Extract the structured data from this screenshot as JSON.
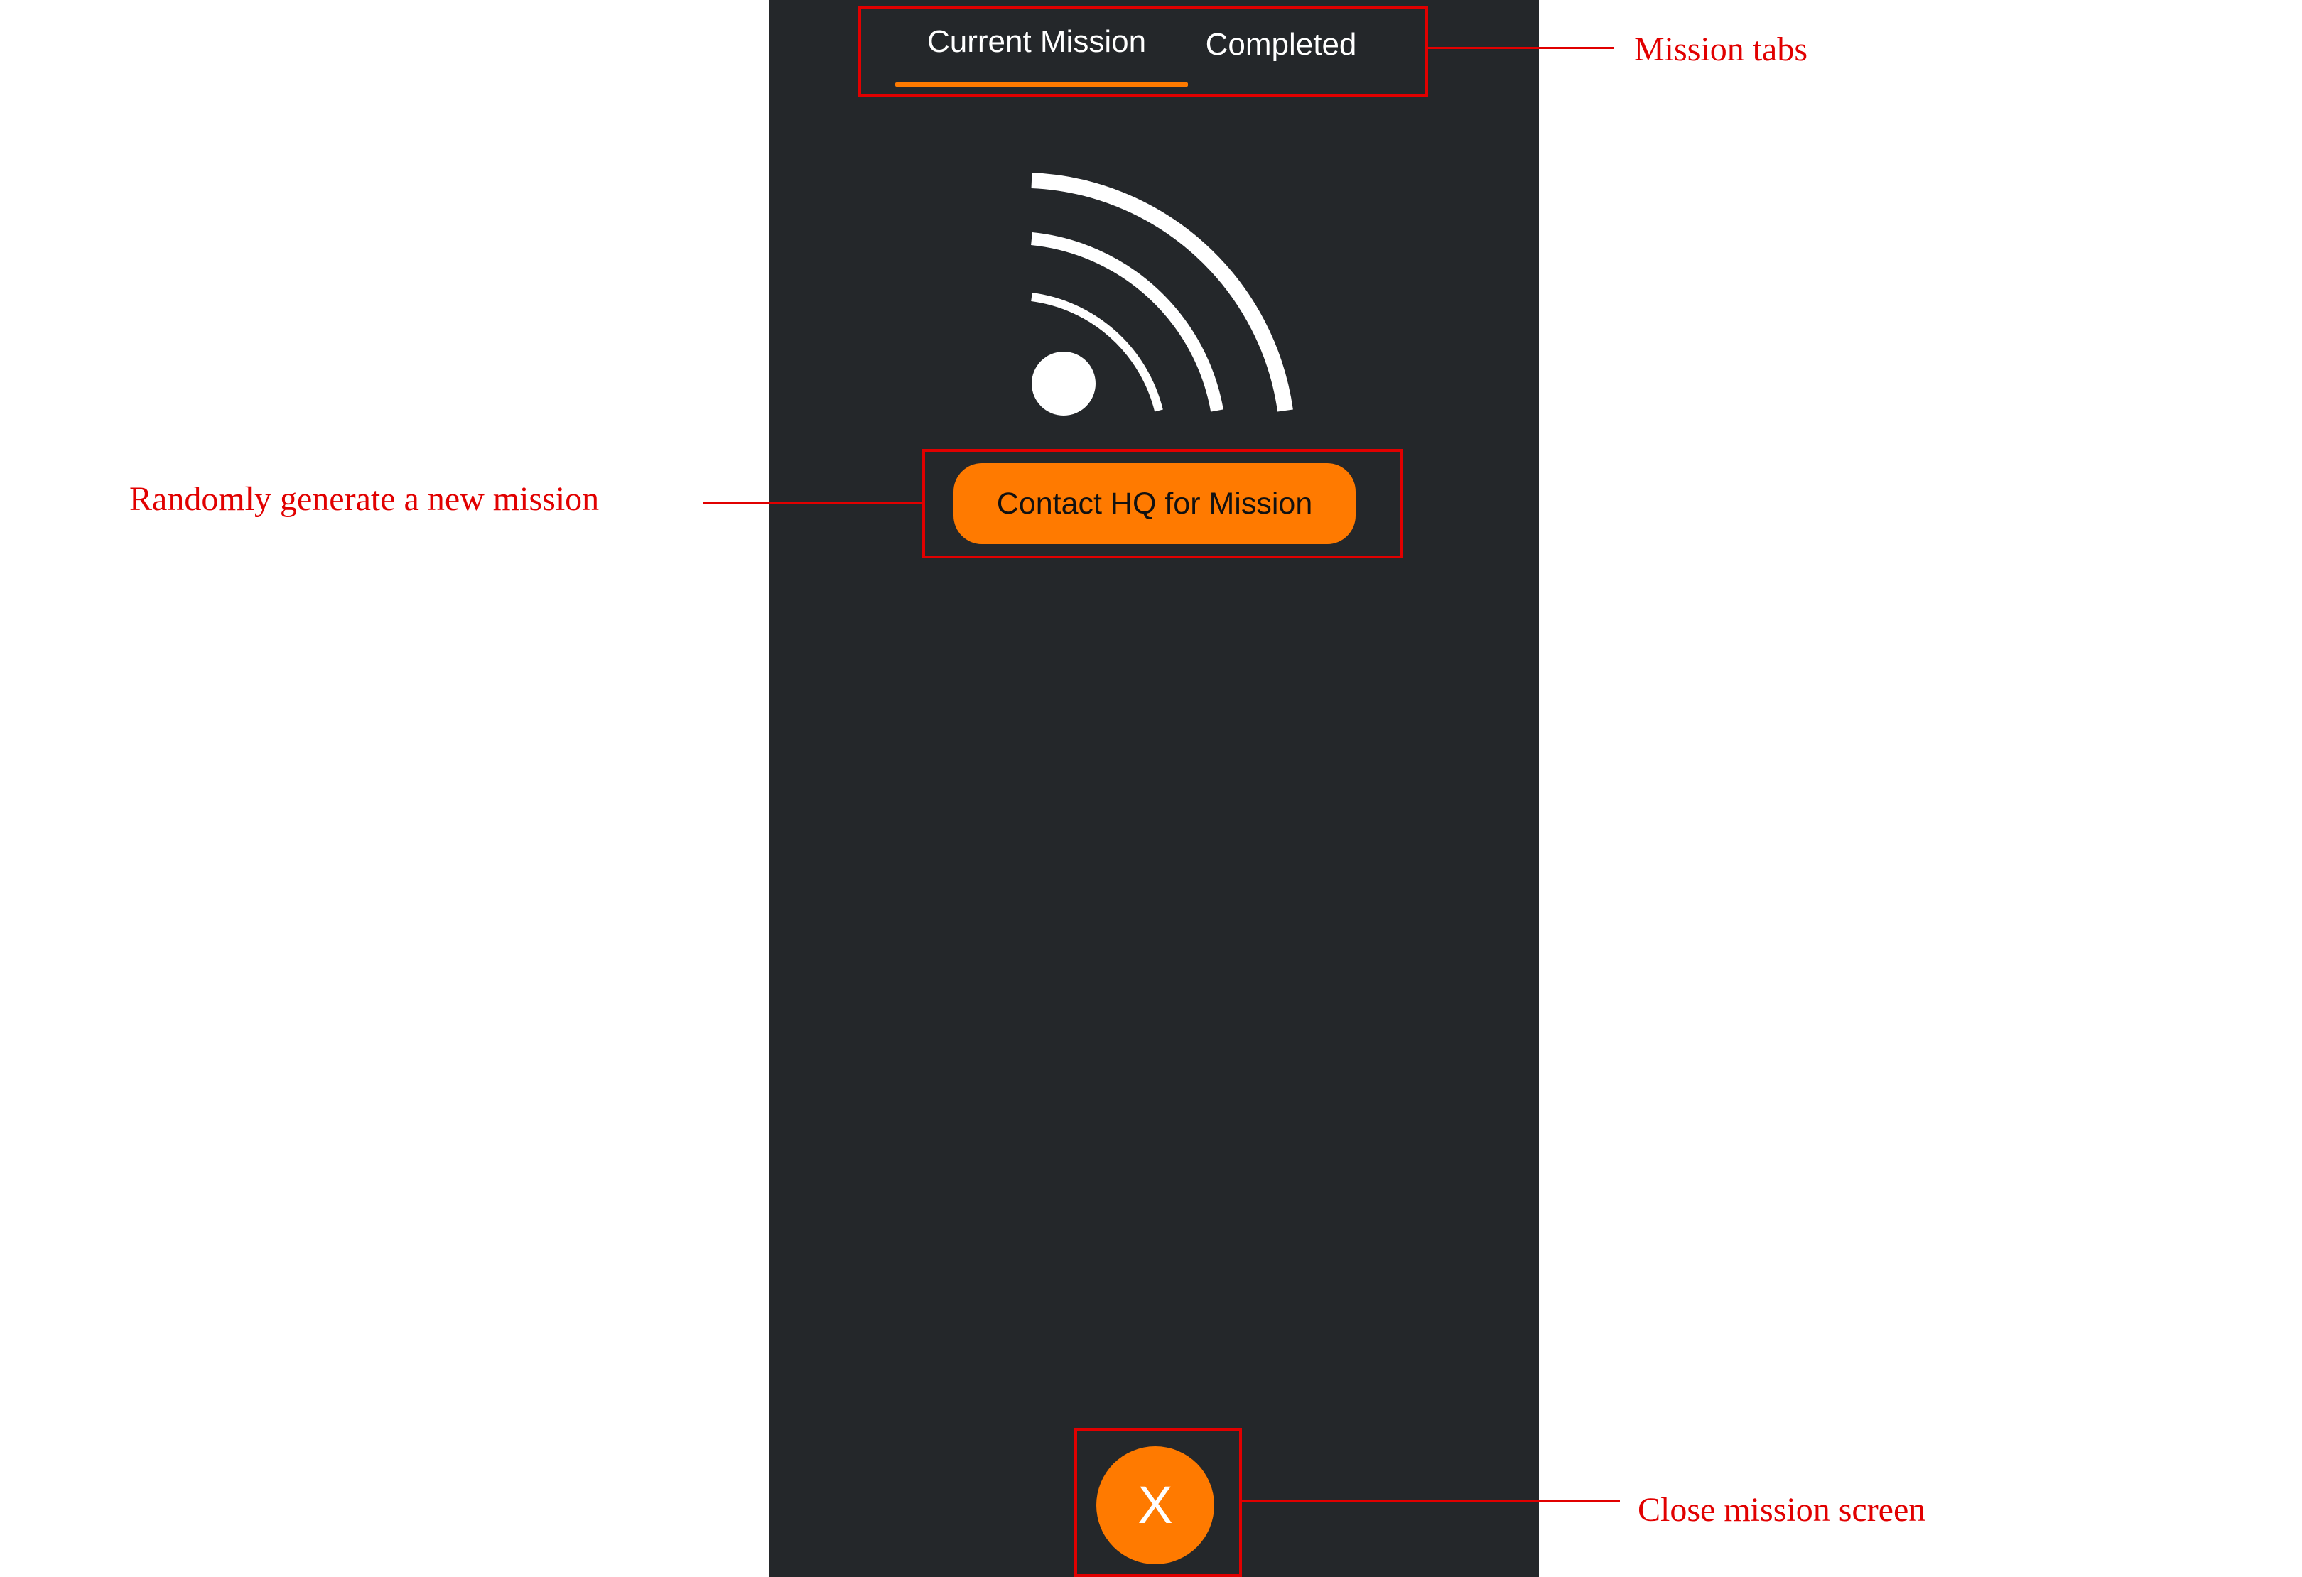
{
  "tabs": [
    {
      "label": "Current Mission",
      "active": true
    },
    {
      "label": "Completed",
      "active": false
    }
  ],
  "icon": "signal-broadcast-icon",
  "actions": {
    "contact_hq_label": "Contact HQ for Mission",
    "close_label": "X"
  },
  "annotations": {
    "mission_tabs": "Mission tabs",
    "generate_mission": "Randomly generate a new mission",
    "close_screen": "Close mission screen"
  },
  "colors": {
    "accent": "#ff7a00",
    "panel_background": "#24272a",
    "annotation": "#e10000"
  }
}
